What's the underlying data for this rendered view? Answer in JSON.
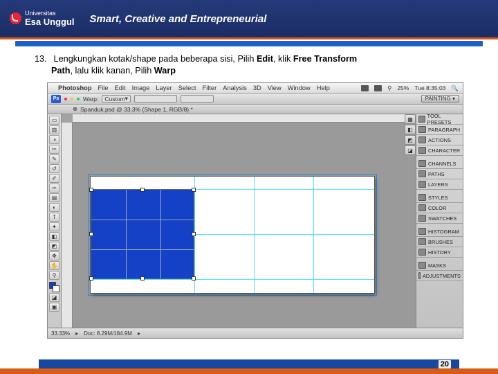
{
  "header": {
    "logo_top": "Universitas",
    "logo_name": "Esa Unggul",
    "tagline": "Smart, Creative and Entrepreneurial"
  },
  "instruction": {
    "number": "13.",
    "line1a": "Lengkungkan kotak/shape pada beberapa sisi, Pilih ",
    "bold1": "Edit",
    "line1b": ", klik ",
    "bold2": "Free Transform",
    "line2a": "Path",
    "line2b": ", lalu klik kanan, Pilih ",
    "bold3": "Warp"
  },
  "ps": {
    "menubar": [
      "Photoshop",
      "File",
      "Edit",
      "Image",
      "Layer",
      "Select",
      "Filter",
      "Analysis",
      "3D",
      "View",
      "Window",
      "Help"
    ],
    "menubar_right": {
      "zoom": "25%",
      "clock": "Tue 8:35:03"
    },
    "options": {
      "warp_label": "Warp:",
      "warp_value": "Custom",
      "mode": "PAINTING"
    },
    "doc_tab": "Spanduk.psd @ 33.3% (Shape 1, RGB/8) *",
    "status": {
      "zoom": "33.33%",
      "info": "Doc: 8.29M/184.9M"
    },
    "panels": [
      "TOOL PRESETS",
      "PARAGRAPH",
      "ACTIONS",
      "CHARACTER",
      "CHANNELS",
      "PATHS",
      "LAYERS",
      "STYLES",
      "COLOR",
      "SWATCHES",
      "HISTOGRAM",
      "BRUSHES",
      "HISTORY",
      "MASKS",
      "ADJUSTMENTS"
    ],
    "tool_glyphs": [
      "▭",
      "▥",
      "◑",
      "✂",
      "✎",
      "↺",
      "✐",
      "✑",
      "▤",
      "◐",
      "T",
      "✦",
      "◧",
      "◩",
      "✥",
      "⌖",
      "✋",
      "⚲"
    ]
  },
  "footer": {
    "page": "20"
  }
}
